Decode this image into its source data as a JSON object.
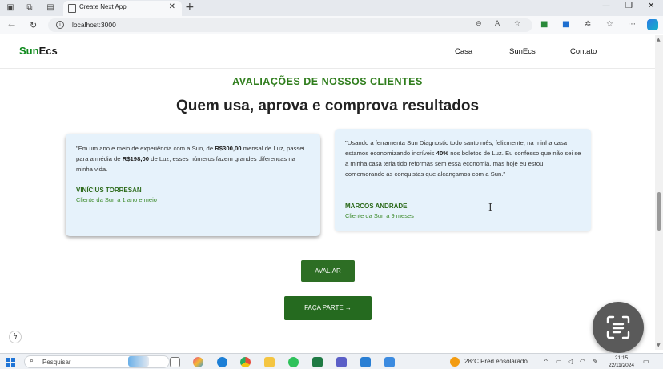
{
  "browser": {
    "tab_title": "Create Next App",
    "url": "localhost:3000"
  },
  "site": {
    "logo_prefix": "Sun",
    "logo_suffix": "Ecs",
    "nav": [
      "Casa",
      "SunEcs",
      "Contato"
    ]
  },
  "section": {
    "eyebrow": "AVALIAÇÕES DE NOSSOS CLIENTES",
    "headline": "Quem usa, aprova e comprova resultados"
  },
  "testimonials": [
    {
      "quote_parts": [
        "\"Em um ano e meio de experiência com a Sun, de ",
        "R$300,00",
        " mensal de Luz, passei para a média de ",
        "R$198,00",
        " de Luz, esses números fazem grandes diferenças na minha vida."
      ],
      "name": "VINÍCIUS TORRESAN",
      "since": "Cliente da Sun a 1 ano e meio"
    },
    {
      "quote_parts": [
        "\"Usando a ferramenta Sun Diagnostic todo santo mês, felizmente, na minha casa estamos economizando incríveis ",
        "40%",
        " nos boletos de Luz. Eu confesso que não sei se a minha casa teria tido reformas sem essa economia, mas hoje eu estou comemorando as conquistas que alcançamos com a Sun.\""
      ],
      "name": "MARCOS ANDRADE",
      "since": "Cliente da Sun a 9 meses"
    }
  ],
  "buttons": {
    "avaliar": "AVALIAR",
    "faca_parte": "FAÇA PARTE →"
  },
  "taskbar": {
    "search_placeholder": "Pesquisar",
    "weather": "28°C  Pred ensolarado",
    "time": "21:15",
    "date": "22/11/2024"
  },
  "colors": {
    "brand_green": "#2d6e24",
    "card_bg": "#e6f2fb",
    "eyebrow_green": "#2f7d1c"
  }
}
